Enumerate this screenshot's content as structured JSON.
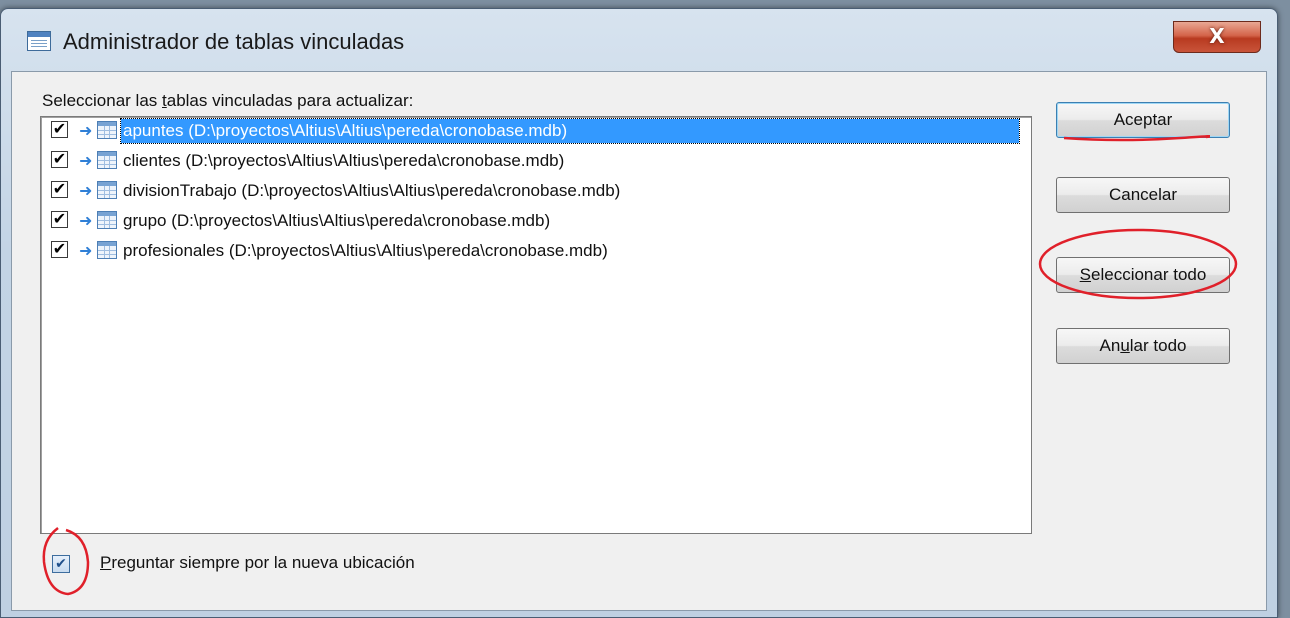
{
  "window": {
    "title": "Administrador de tablas vinculadas",
    "close_glyph": "X"
  },
  "list": {
    "caption_pre": "Seleccionar las ",
    "caption_u": "t",
    "caption_post": "ablas vinculadas para actualizar:",
    "check_glyph": "✔",
    "arrow_glyph": "➜",
    "items": [
      {
        "label": "apuntes   (D:\\proyectos\\Altius\\Altius\\pereda\\cronobase.mdb)",
        "checked": true,
        "selected": true
      },
      {
        "label": "clientes   (D:\\proyectos\\Altius\\Altius\\pereda\\cronobase.mdb)",
        "checked": true,
        "selected": false
      },
      {
        "label": "divisionTrabajo   (D:\\proyectos\\Altius\\Altius\\pereda\\cronobase.mdb)",
        "checked": true,
        "selected": false
      },
      {
        "label": "grupo   (D:\\proyectos\\Altius\\Altius\\pereda\\cronobase.mdb)",
        "checked": true,
        "selected": false
      },
      {
        "label": "profesionales   (D:\\proyectos\\Altius\\Altius\\pereda\\cronobase.mdb)",
        "checked": true,
        "selected": false
      }
    ]
  },
  "buttons": {
    "accept": "Aceptar",
    "cancel": "Cancelar",
    "select_all_u": "S",
    "select_all_rest": "eleccionar todo",
    "unselect_pre": "An",
    "unselect_u": "u",
    "unselect_post": "lar todo"
  },
  "always_ask": {
    "checked": true,
    "check_glyph": "✔",
    "label_u": "P",
    "label_rest": "reguntar siempre por la nueva ubicación"
  },
  "annotation_color": "#e0202a"
}
